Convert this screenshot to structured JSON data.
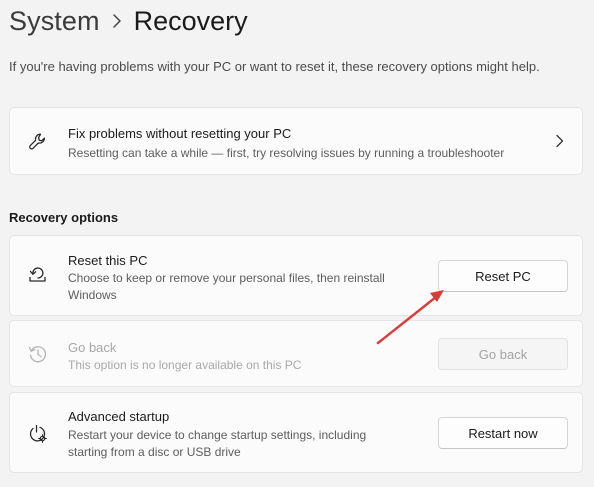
{
  "breadcrumb": {
    "parent": "System",
    "separator_icon": "chevron-right-icon",
    "current": "Recovery"
  },
  "intro": "If you're having problems with your PC or want to reset it, these recovery options might help.",
  "fix_card": {
    "icon": "wrench-icon",
    "title": "Fix problems without resetting your PC",
    "description": "Resetting can take a while — first, try resolving issues by running a troubleshooter",
    "chevron_icon": "chevron-right-icon"
  },
  "section_title": "Recovery options",
  "options": {
    "reset": {
      "icon": "reset-pc-icon",
      "title": "Reset this PC",
      "description": "Choose to keep or remove your personal files, then reinstall Windows",
      "button": "Reset PC"
    },
    "go_back": {
      "icon": "history-icon",
      "title": "Go back",
      "description": "This option is no longer available on this PC",
      "button": "Go back",
      "disabled": true
    },
    "advanced": {
      "icon": "advanced-startup-icon",
      "title": "Advanced startup",
      "description": "Restart your device to change startup settings, including starting from a disc or USB drive",
      "button": "Restart now"
    }
  },
  "annotation": {
    "icon": "red-arrow-annotation",
    "color": "#d93a3a"
  },
  "colors": {
    "background": "#f3f3f3",
    "card": "#fbfbfb",
    "disabled_text": "#a8a8a8"
  }
}
